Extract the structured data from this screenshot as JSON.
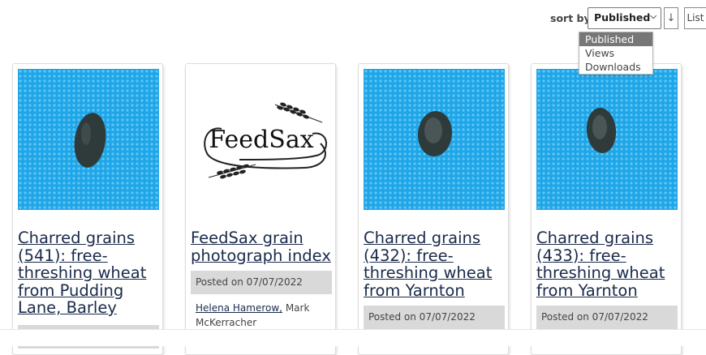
{
  "sort": {
    "label": "sort by:",
    "selected": "Published",
    "direction_icon": "↓",
    "list_label": "List",
    "options": [
      "Published",
      "Views",
      "Downloads"
    ]
  },
  "cards": [
    {
      "title": "Charred grains (541): free-threshing wheat from Pudding Lane, Barley",
      "posted": "",
      "thumb": "blue-grain"
    },
    {
      "title": "FeedSax grain photograph index",
      "posted": "Posted on 07/07/2022",
      "thumb": "feedsax-logo",
      "logo_text": "FeedSax",
      "authors": {
        "link": "Helena Hamerow,",
        "rest": " Mark McKerracher"
      }
    },
    {
      "title": "Charred grains (432): free-threshing wheat from Yarnton",
      "posted": "Posted on 07/07/2022",
      "thumb": "blue-grain"
    },
    {
      "title": "Charred grains (433): free-threshing wheat from Yarnton",
      "posted": "Posted on 07/07/2022",
      "thumb": "blue-grain"
    }
  ],
  "colors": {
    "thumb_blue": "#1fa6e8",
    "grain_dark": "#2f3a3a",
    "posted_bg": "#d9d9d9",
    "link": "#1a2a4a"
  }
}
